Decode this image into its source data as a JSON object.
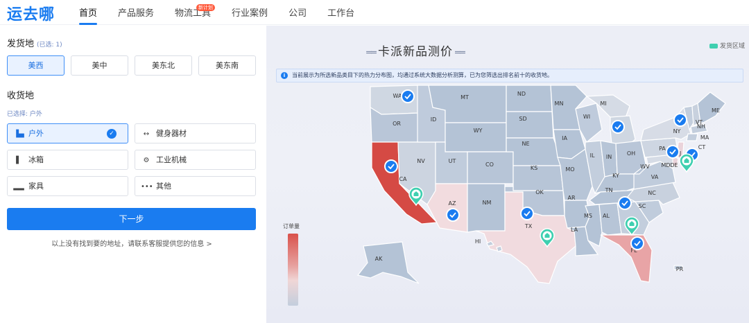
{
  "header": {
    "logo": "运去哪",
    "nav": [
      {
        "label": "首页",
        "active": true
      },
      {
        "label": "产品服务"
      },
      {
        "label": "物流工具",
        "badge": "新计划"
      },
      {
        "label": "行业案例"
      },
      {
        "label": "公司"
      },
      {
        "label": "工作台"
      }
    ]
  },
  "origin": {
    "title": "发货地",
    "selected_count": "(已选: 1)",
    "options": [
      "美西",
      "美中",
      "美东北",
      "美东南"
    ],
    "selected": "美西"
  },
  "destination": {
    "title": "收货地",
    "selected_note": "已选择: 户外",
    "categories": [
      {
        "label": "户外",
        "icon": "shoe-icon",
        "selected": true
      },
      {
        "label": "健身器材",
        "icon": "dumbbell-icon"
      },
      {
        "label": "冰箱",
        "icon": "fridge-icon"
      },
      {
        "label": "工业机械",
        "icon": "gear-icon"
      },
      {
        "label": "家具",
        "icon": "sofa-icon"
      },
      {
        "label": "其他",
        "icon": "more-icon"
      }
    ],
    "next_label": "下一步",
    "help_link": "以上没有找到要的地址，请联系客服提供您的信息 >"
  },
  "map": {
    "title": "卡派新品测价",
    "legend_label": "发货区域",
    "info_text": "当前展示为所选新品类目下的热力分布图，均通过系统大数据分析测算，已为您筛选出排名前十的收货地。",
    "heat_label": "订单量",
    "colors": {
      "hot": "#d94a44",
      "warm": "#e9a6a6",
      "light": "#f2dcdf",
      "base": "#b4c3d6",
      "check": "#1a7cf0",
      "pin": "#3fcfb0"
    },
    "states": [
      "WA",
      "MT",
      "ND",
      "MN",
      "MI",
      "ME",
      "OR",
      "ID",
      "WY",
      "SD",
      "WI",
      "NY",
      "VT",
      "NH",
      "MA",
      "CT",
      "NV",
      "UT",
      "NE",
      "IA",
      "PA",
      "NJ",
      "DE",
      "MD",
      "CA",
      "CO",
      "KS",
      "MO",
      "IL",
      "IN",
      "OH",
      "WV",
      "VA",
      "AZ",
      "NM",
      "OK",
      "AR",
      "TN",
      "KY",
      "NC",
      "SC",
      "GA",
      "AL",
      "MS",
      "TX",
      "LA",
      "FL",
      "AK",
      "HI",
      "PR",
      "RI",
      "DC"
    ],
    "top_destinations": [
      "WA",
      "CA",
      "AZ",
      "TX",
      "GA",
      "FL",
      "MI",
      "NY",
      "NJ",
      "DE"
    ],
    "warehouses": [
      "CA",
      "TX",
      "GA",
      "NJ"
    ]
  }
}
